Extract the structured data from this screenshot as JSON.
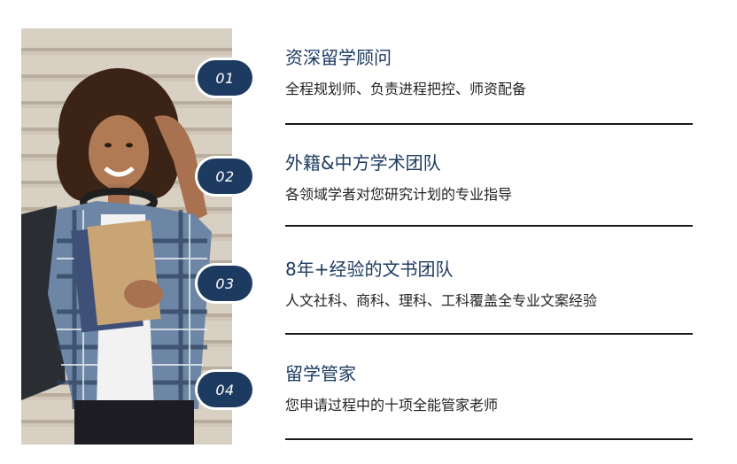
{
  "features": [
    {
      "number": "01",
      "title": "资深留学顾问",
      "desc": "全程规划师、负责进程把控、师资配备"
    },
    {
      "number": "02",
      "title": "外籍&中方学术团队",
      "desc": "各领域学者对您研究计划的专业指导"
    },
    {
      "number": "03",
      "title": "8年+经验的文书团队",
      "desc": "人文社科、商科、理科、工科覆盖全专业文案经验"
    },
    {
      "number": "04",
      "title": "留学管家",
      "desc": "您申请过程中的十项全能管家老师"
    }
  ],
  "colors": {
    "accent": "#1d3b61",
    "text": "#222222",
    "divider": "#1a1a1a"
  }
}
